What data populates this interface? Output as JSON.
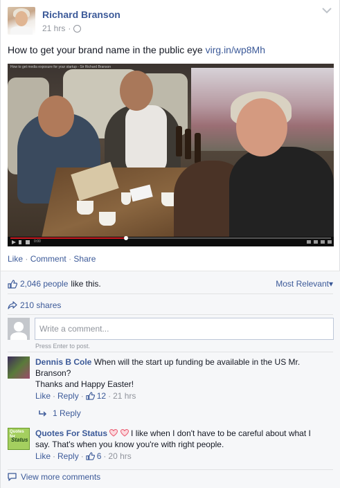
{
  "post": {
    "author": "Richard Branson",
    "time": "21 hrs",
    "meta_separator": "·",
    "text": "How to get your brand name in the public eye",
    "link": "virg.in/wp8Mh",
    "video": {
      "title_overlay": "How to get media exposure for your startup - Sir Richard Branson",
      "time_display": "0:00",
      "progress_fraction": 0.36
    },
    "actions": {
      "like": "Like",
      "comment": "Comment",
      "share": "Share",
      "separator": "·"
    }
  },
  "ufi": {
    "likes_count": "2,046 people",
    "likes_suffix": "like this.",
    "sort_label": "Most Relevant",
    "sort_caret": "▾",
    "shares": "210 shares",
    "comment_placeholder": "Write a comment...",
    "enter_hint": "Press Enter to post."
  },
  "comments": [
    {
      "name": "Dennis B Cole",
      "text": "When will the start up funding be available in the US Mr. Branson?",
      "text2": "Thanks and Happy Easter!",
      "like": "Like",
      "reply": "Reply",
      "likes": "12",
      "time": "21 hrs",
      "replies": "1 Reply"
    },
    {
      "name": "Quotes For Status",
      "avatar_top": "Quotes for",
      "avatar_bottom": "Status",
      "text": "I like when I don't have to be careful about what I say. That's when you know you're with right people.",
      "like": "Like",
      "reply": "Reply",
      "likes": "6",
      "time": "20 hrs"
    }
  ],
  "view_more": "View more comments",
  "colors": {
    "link": "#3b5998",
    "muted": "#90949c",
    "heart": "#e9546b"
  }
}
